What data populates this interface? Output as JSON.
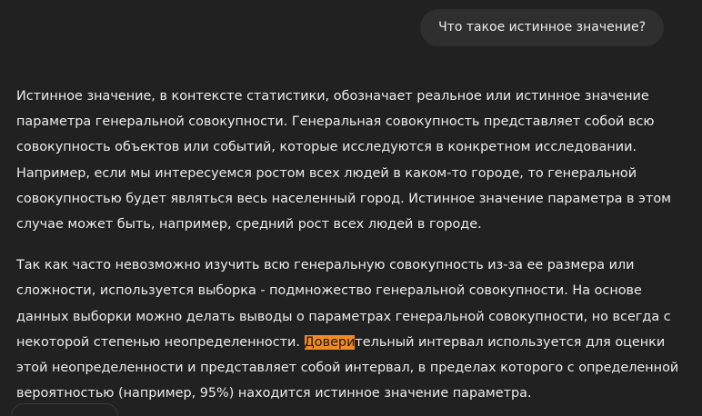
{
  "colors": {
    "background": "#212121",
    "bubble": "#2f2f2f",
    "text": "#ececec",
    "highlight": "#f08a24"
  },
  "user_message": {
    "text": "Что такое истинное значение?"
  },
  "reply": {
    "p1": "Истинное значение, в контексте статистики, обозначает реальное или истинное значение параметра генеральной совокупности. Генеральная совокупность представляет собой всю совокупность объектов или событий, которые исследуются в конкретном исследовании. Например, если мы интересуемся ростом всех людей в каком-то городе, то генеральной совокупностью будет являться весь населенный город. Истинное значение параметра в этом случае может быть, например, средний рост всех людей в городе.",
    "p2_before": "Так как часто невозможно изучить всю генеральную совокупность из-за ее размера или сложности, используется выборка - подмножество генеральной совокупности. На основе данных выборки можно делать выводы о параметрах генеральной совокупности, но всегда с некоторой степенью неопределенности. ",
    "p2_highlight": "Довери",
    "p2_after": "тельный интервал используется для оценки этой неопределенности и представляет собой интервал, в пределах которого с определенной вероятностью (например, 95%) находится истинное значение параметра."
  }
}
